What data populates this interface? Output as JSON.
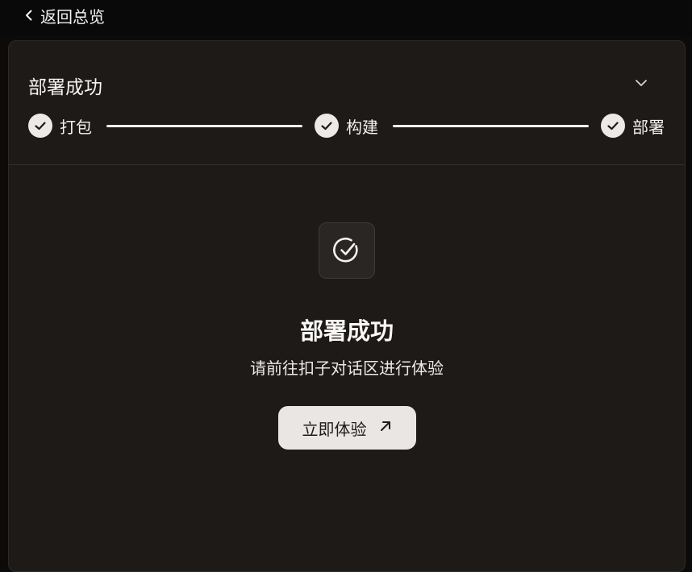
{
  "nav": {
    "back_label": "返回总览"
  },
  "header": {
    "title": "部署成功"
  },
  "steps": [
    {
      "label": "打包",
      "status": "done"
    },
    {
      "label": "构建",
      "status": "done"
    },
    {
      "label": "部署",
      "status": "done"
    }
  ],
  "result": {
    "title": "部署成功",
    "subtitle": "请前往扣子对话区进行体验",
    "button_label": "立即体验"
  },
  "colors": {
    "background": "#0c0b0a",
    "card": "#1d1a18",
    "accent_light": "#ece9e6",
    "text": "#f4f2f0"
  }
}
